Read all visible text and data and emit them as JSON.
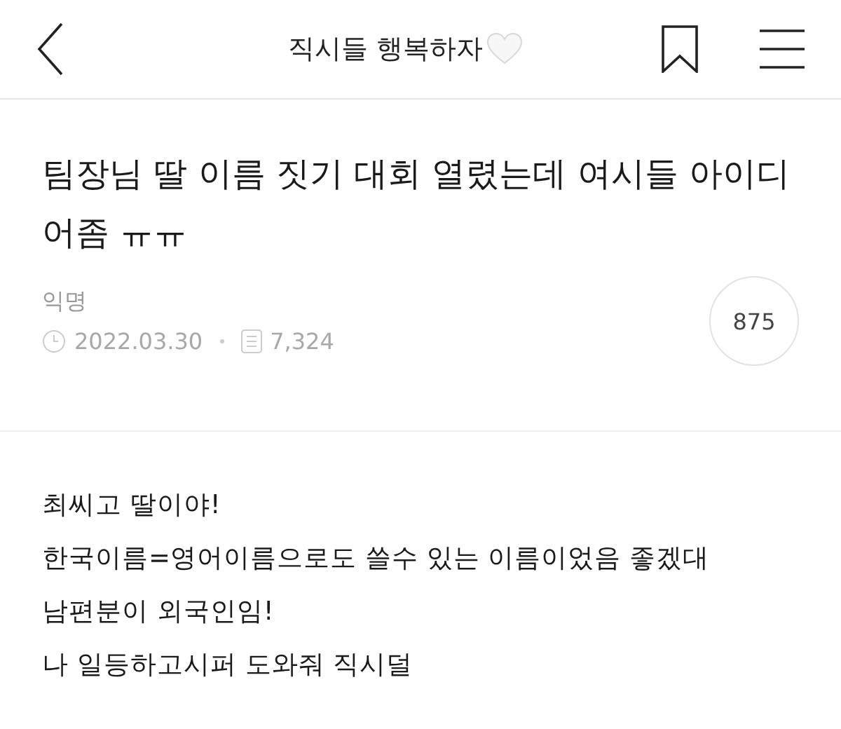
{
  "header": {
    "title": "직시들 행복하자"
  },
  "post": {
    "title": "팀장님 딸 이름 짓기 대회 열렸는데 여시들 아이디어좀 ㅠㅠ",
    "author": "익명",
    "date": "2022.03.30",
    "views": "7,324",
    "count": "875"
  },
  "body": [
    "최씨고 딸이야!",
    "한국이름=영어이름으로도 쓸수 있는 이름이었음 좋겠대",
    "남편분이 외국인임!",
    "나 일등하고시퍼 도와줘 직시덜"
  ]
}
